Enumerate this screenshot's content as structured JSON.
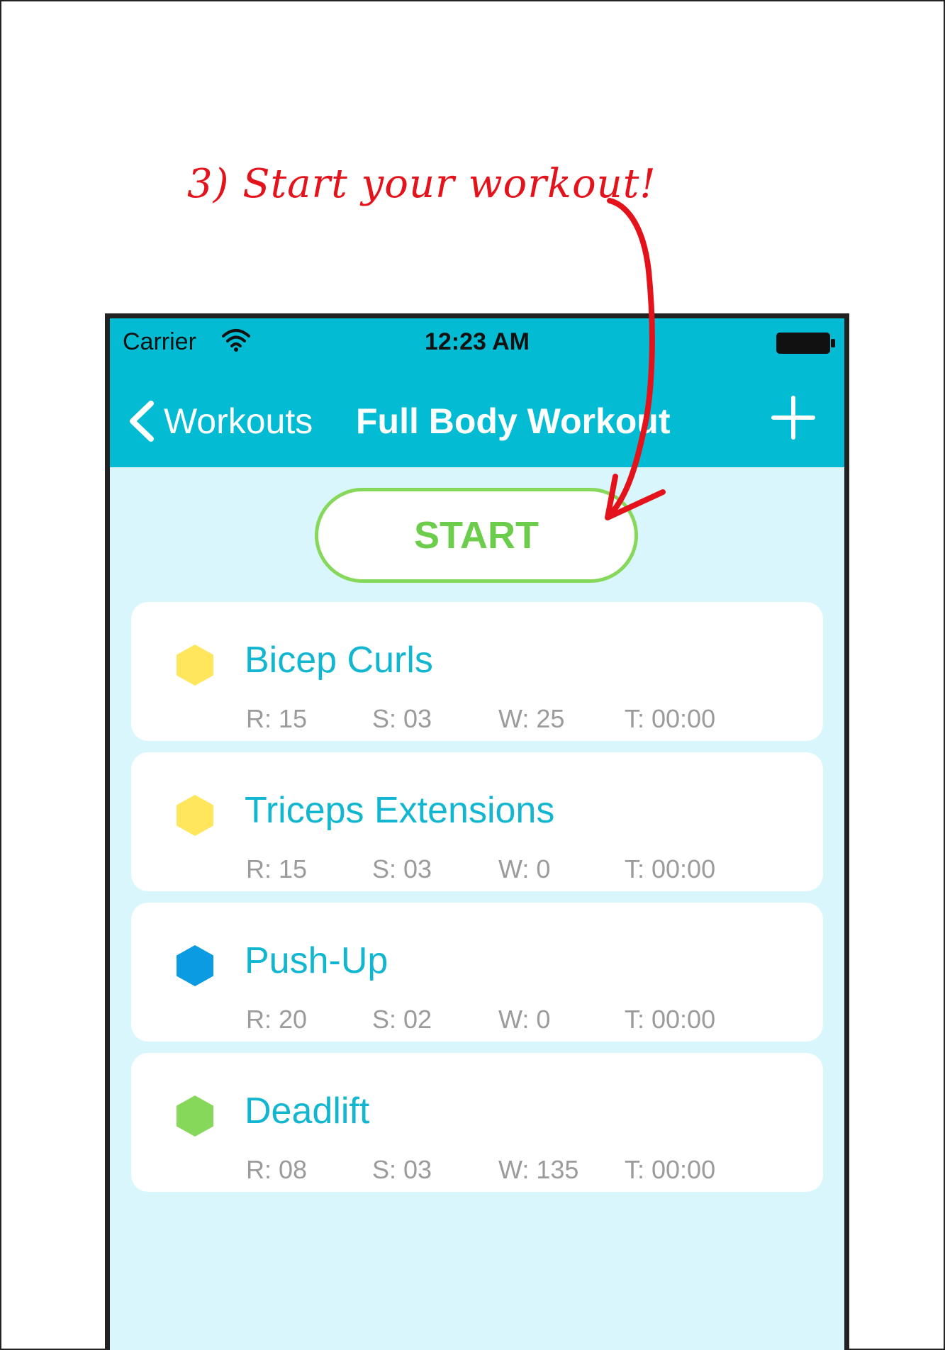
{
  "annotation": {
    "text": "3) Start your workout!",
    "color": "#e4121a"
  },
  "status_bar": {
    "carrier": "Carrier",
    "time": "12:23 AM"
  },
  "nav": {
    "back_label": "Workouts",
    "title": "Full Body Workout",
    "add_icon": "plus-icon"
  },
  "start_button": {
    "label": "START",
    "color": "#6bcd4b"
  },
  "exercises": [
    {
      "name": "Bicep Curls",
      "icon_color": "#ffe65c",
      "reps": "R: 15",
      "sets": "S: 03",
      "weight": "W: 25",
      "time": "T: 00:00"
    },
    {
      "name": "Triceps Extensions",
      "icon_color": "#ffe65c",
      "reps": "R: 15",
      "sets": "S: 03",
      "weight": "W: 0",
      "time": "T: 00:00"
    },
    {
      "name": "Push-Up",
      "icon_color": "#0a9be2",
      "reps": "R: 20",
      "sets": "S: 02",
      "weight": "W: 0",
      "time": "T: 00:00"
    },
    {
      "name": "Deadlift",
      "icon_color": "#86d85a",
      "reps": "R: 08",
      "sets": "S: 03",
      "weight": "W: 135",
      "time": "T: 00:00"
    }
  ],
  "theme": {
    "header_color": "#03bcd4",
    "background_color": "#d8f6fb",
    "exercise_name_color": "#12b6d0"
  }
}
